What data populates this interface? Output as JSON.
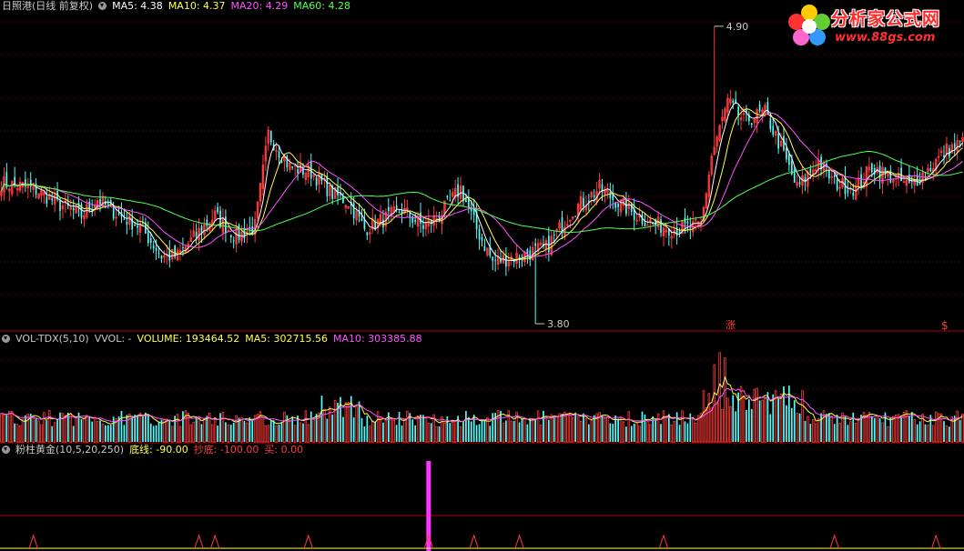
{
  "main_header": {
    "title": "日照港(日线 前复权)",
    "ma5": "MA5: 4.38",
    "ma10": "MA10: 4.37",
    "ma20": "MA20: 4.29",
    "ma60": "MA60: 4.28"
  },
  "vol_header": {
    "name": "VOL-TDX(5,10)",
    "vvol": "VVOL: -",
    "volume": "VOLUME: 193464.52",
    "ma5": "MA5: 302715.56",
    "ma10": "MA10: 303385.88"
  },
  "ind_header": {
    "name": "粉柱黄金(10,5,20,250)",
    "dixian": "底线: -90.00",
    "chaodi": "抄底: -100.00",
    "mai": "买: 0.00"
  },
  "logo": {
    "brand": "分析家公式网",
    "url": "www.88gs.com"
  },
  "annotations": {
    "high_label": "4.90",
    "low_label": "3.80",
    "zhang_mark": "涨",
    "dollar_mark": "$"
  },
  "colors": {
    "up": "#ff3b3b",
    "down": "#54fcfc",
    "ma5": "#ffffff",
    "ma10": "#ffff54",
    "ma20": "#ff54ff",
    "ma60": "#54ff54",
    "grid": "#8b0000",
    "ind_pink": "#ff33ff"
  },
  "chart_data": {
    "type": "candlestick",
    "price_range": [
      3.78,
      4.95
    ],
    "high": 4.9,
    "low": 3.8,
    "ma": {
      "ma5": 4.38,
      "ma10": 4.37,
      "ma20": 4.29,
      "ma60": 4.28
    },
    "volume_last": 193464.52,
    "volume_ma5": 302715.56,
    "volume_ma10": 303385.88,
    "indicator": {
      "dixian": -90.0,
      "chaodi": -100.0,
      "mai": 0.0
    },
    "price_waypoints": [
      [
        0,
        4.32
      ],
      [
        12,
        4.3
      ],
      [
        22,
        4.24
      ],
      [
        30,
        4.2
      ],
      [
        36,
        4.26
      ],
      [
        44,
        4.2
      ],
      [
        52,
        4.16
      ],
      [
        60,
        4.05
      ],
      [
        66,
        4.05
      ],
      [
        74,
        4.14
      ],
      [
        80,
        4.2
      ],
      [
        88,
        4.12
      ],
      [
        95,
        4.16
      ],
      [
        100,
        4.5
      ],
      [
        108,
        4.38
      ],
      [
        116,
        4.36
      ],
      [
        124,
        4.28
      ],
      [
        130,
        4.25
      ],
      [
        136,
        4.15
      ],
      [
        142,
        4.18
      ],
      [
        150,
        4.22
      ],
      [
        158,
        4.16
      ],
      [
        164,
        4.2
      ],
      [
        172,
        4.3
      ],
      [
        178,
        4.15
      ],
      [
        184,
        4.03
      ],
      [
        194,
        4.05
      ],
      [
        204,
        4.08
      ],
      [
        214,
        4.22
      ],
      [
        224,
        4.3
      ],
      [
        232,
        4.24
      ],
      [
        238,
        4.2
      ],
      [
        244,
        4.17
      ],
      [
        252,
        4.15
      ],
      [
        262,
        4.16
      ],
      [
        266,
        4.42
      ],
      [
        272,
        4.62
      ],
      [
        278,
        4.55
      ],
      [
        286,
        4.58
      ],
      [
        292,
        4.45
      ],
      [
        298,
        4.3
      ],
      [
        306,
        4.4
      ],
      [
        312,
        4.32
      ],
      [
        320,
        4.3
      ],
      [
        326,
        4.38
      ],
      [
        332,
        4.35
      ],
      [
        340,
        4.31
      ],
      [
        346,
        4.36
      ],
      [
        354,
        4.44
      ],
      [
        360,
        4.47
      ]
    ],
    "volume_spike_bars": [
      267,
      269,
      271
    ],
    "indicator_spike_bar": 160,
    "indicator_triangle_bars": [
      12,
      74,
      80,
      115,
      160,
      177,
      194,
      248,
      312,
      350
    ]
  }
}
